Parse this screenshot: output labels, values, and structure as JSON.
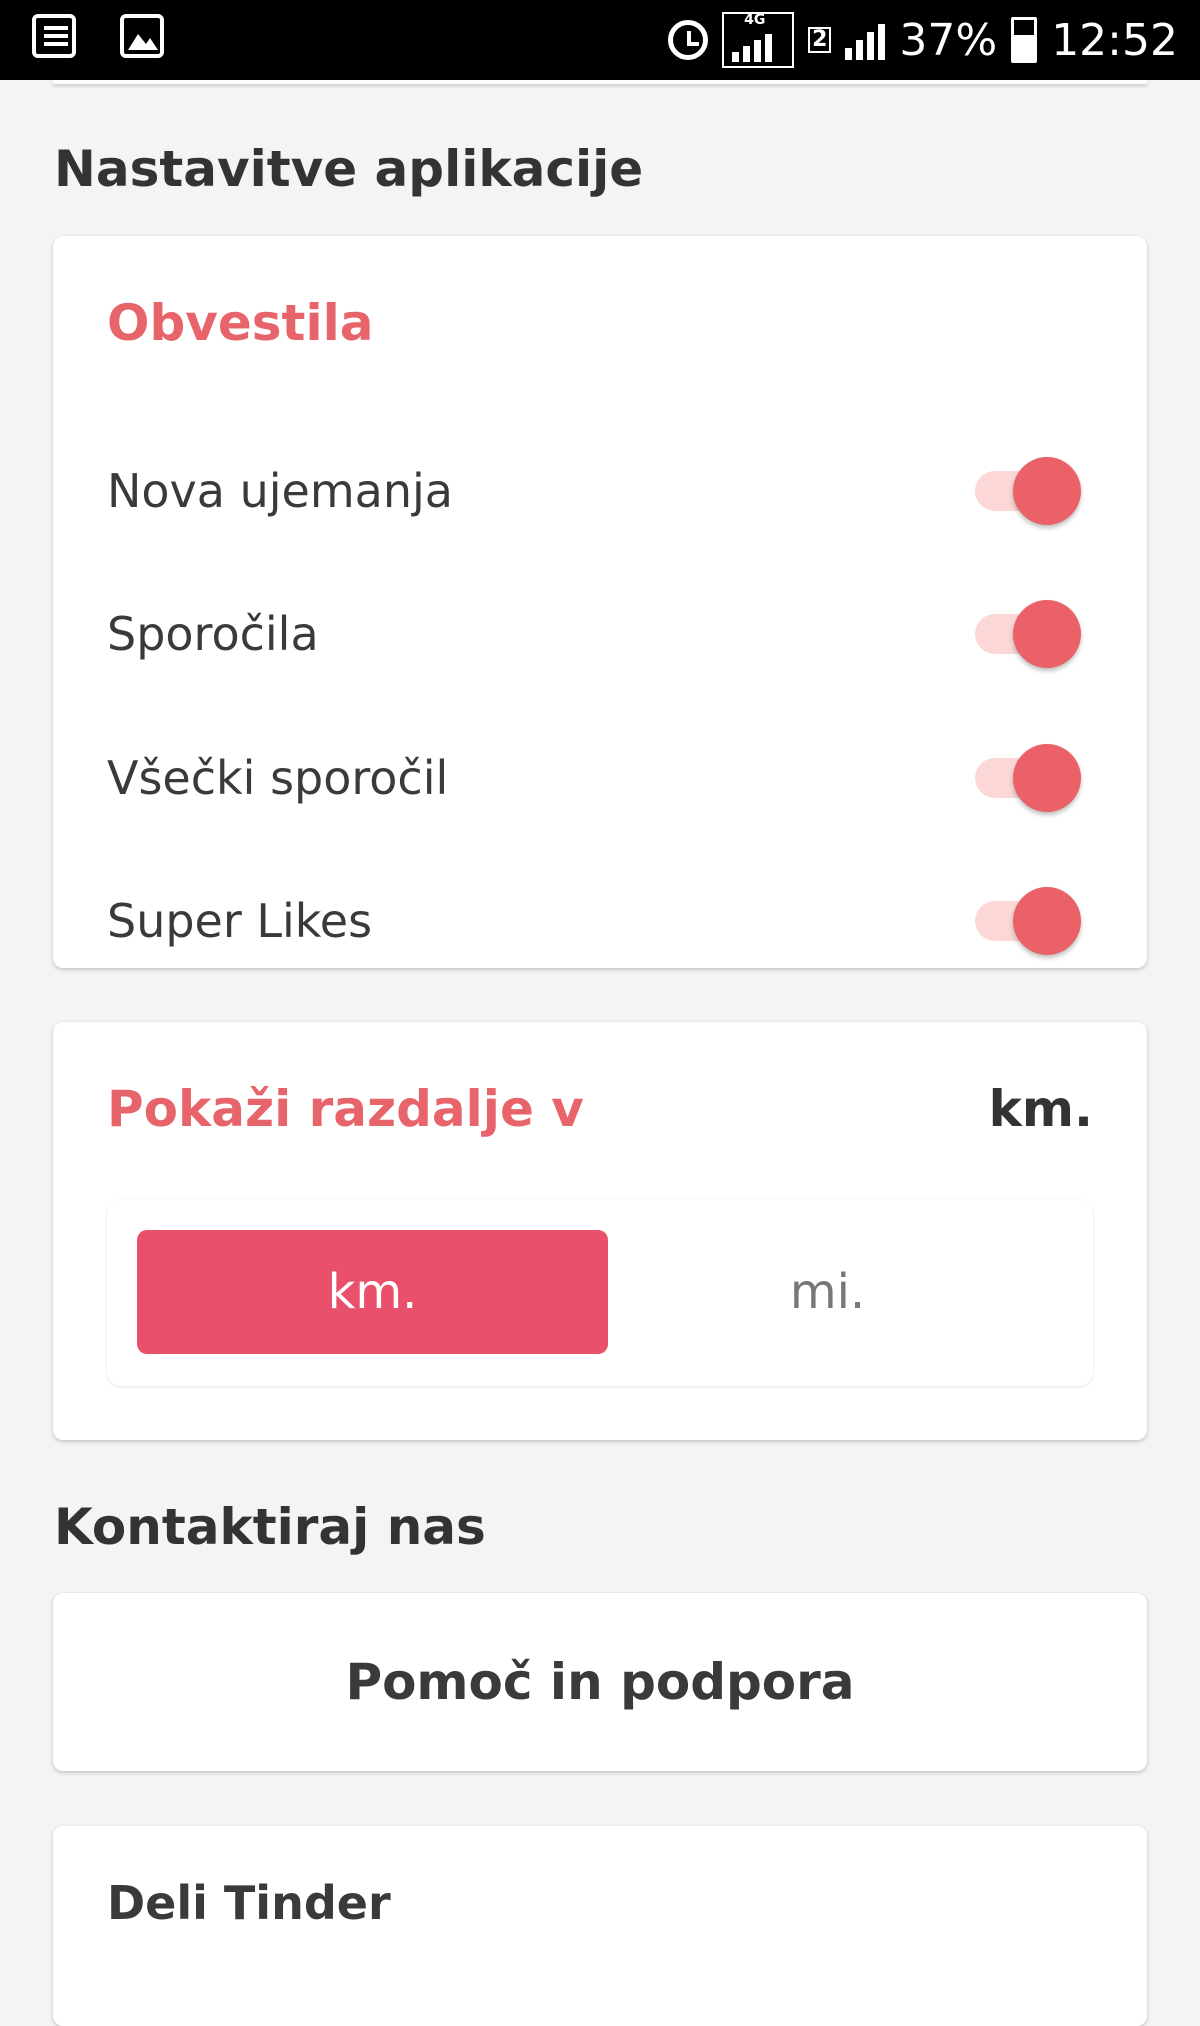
{
  "status_bar": {
    "battery": "37%",
    "time": "12:52",
    "network": "4G",
    "sim2": "2"
  },
  "app_settings": {
    "section_title": "Nastavitve aplikacije",
    "notifications": {
      "title": "Obvestila",
      "items": [
        {
          "label": "Nova ujemanja",
          "on": true
        },
        {
          "label": "Sporočila",
          "on": true
        },
        {
          "label": "Všečki sporočil",
          "on": true
        },
        {
          "label": "Super Likes",
          "on": true
        }
      ]
    },
    "distance": {
      "title": "Pokaži razdalje v",
      "current": "km.",
      "options": [
        "km.",
        "mi."
      ],
      "selected": "km."
    }
  },
  "contact": {
    "section_title": "Kontaktiraj nas",
    "help_button": "Pomoč in podpora",
    "share_label": "Deli Tinder"
  },
  "colors": {
    "accent": "#e8646b",
    "selected_segment": "#e8506b",
    "toggle_track": "#fbd7d7"
  }
}
